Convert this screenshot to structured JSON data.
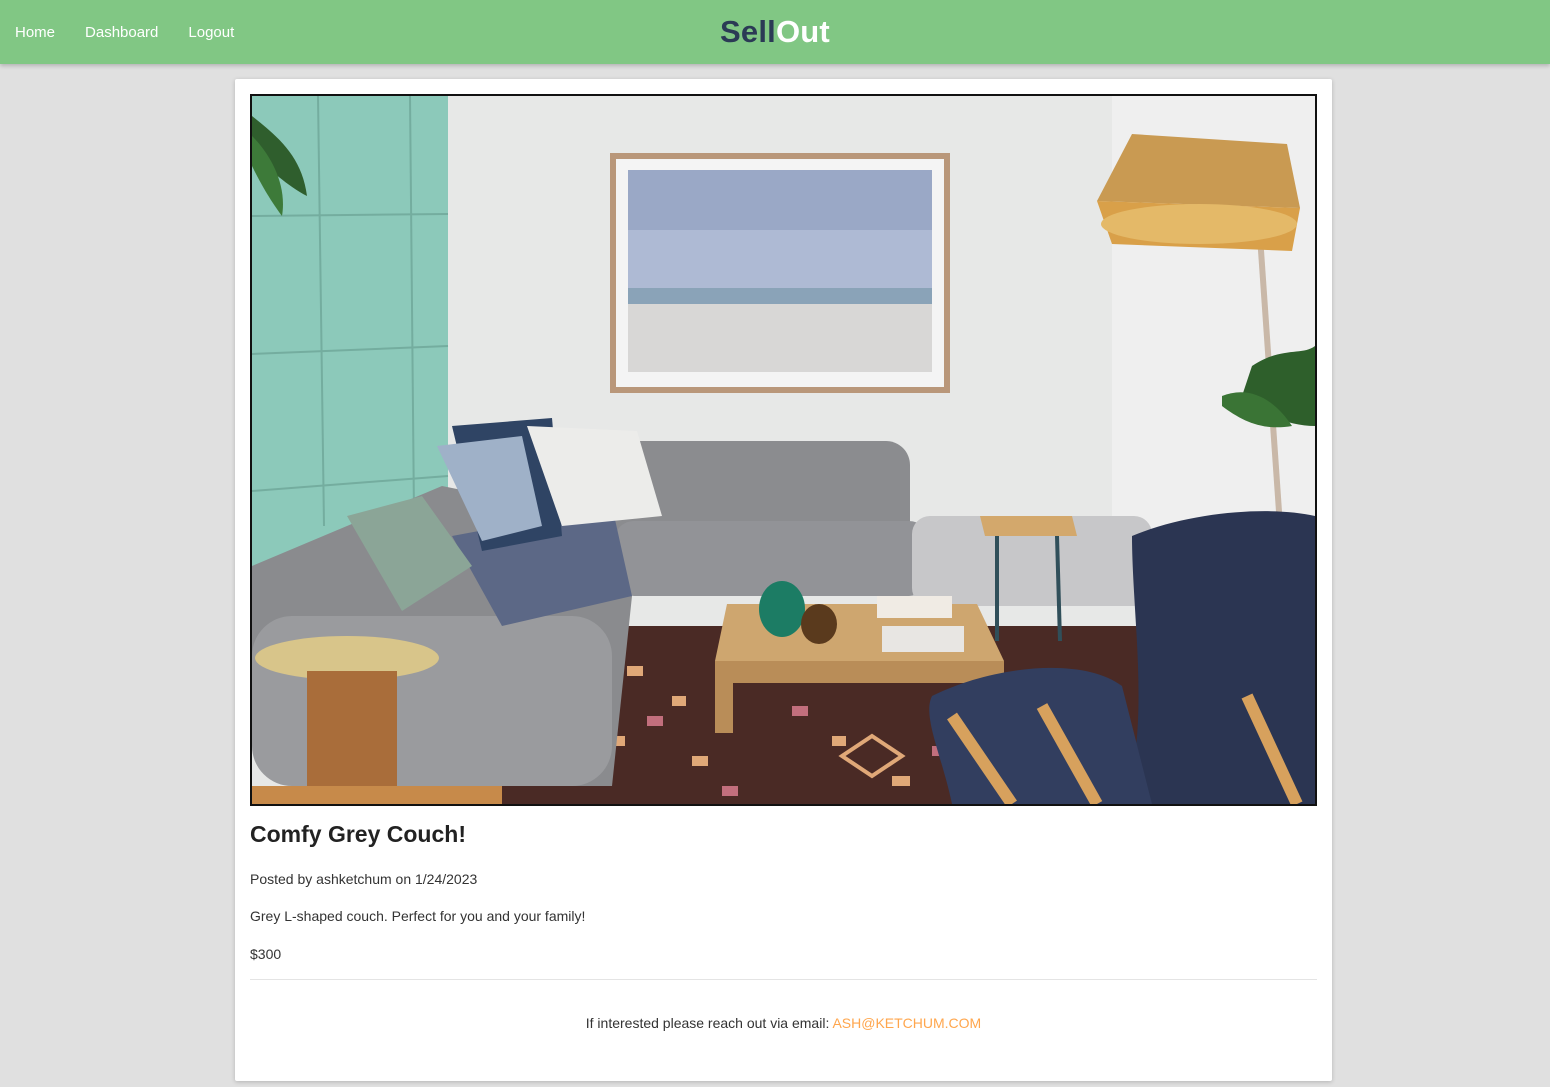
{
  "nav": {
    "links": [
      "Home",
      "Dashboard",
      "Logout"
    ]
  },
  "brand": {
    "part1": "Sell",
    "part2": "Out",
    "part1_color": "#2b3a55",
    "part2_color": "#ffffff",
    "navbar_color": "#81c784"
  },
  "listing": {
    "image_alt": "Living room with grey L-shaped couch",
    "title": "Comfy Grey Couch!",
    "posted_prefix": "Posted by",
    "author": "ashketchum",
    "posted_on": "on",
    "date": "1/24/2023",
    "description": "Grey L-shaped couch. Perfect for you and your family!",
    "price": "$300"
  },
  "contact": {
    "text": "If interested please reach out via email:",
    "email": "ASH@KETCHUM.COM",
    "email_color": "#ffa64d"
  }
}
